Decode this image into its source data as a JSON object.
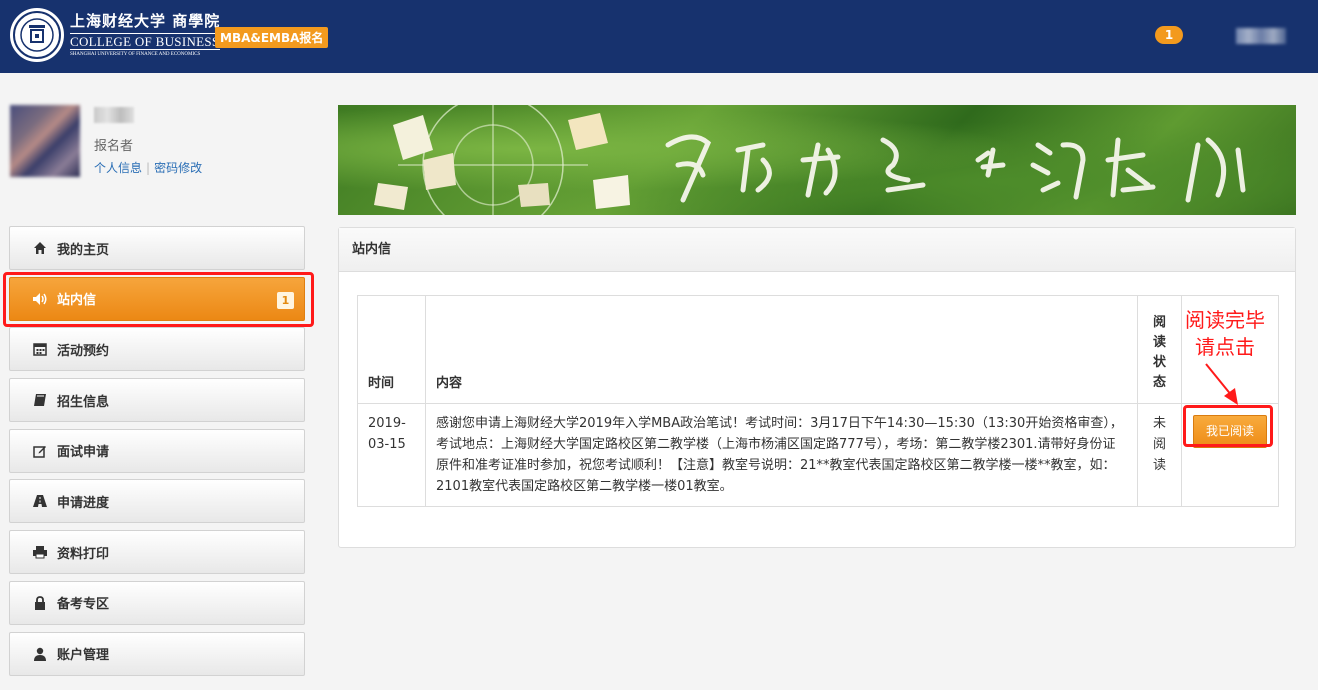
{
  "header": {
    "logo_cn": "上海财经大学 商學院",
    "logo_en": "COLLEGE OF BUSINESS",
    "logo_en_small": "SHANGHAI UNIVERSITY OF FINANCE AND ECONOMICS",
    "program_badge": "MBA&EMBA报名",
    "notification_count": "1"
  },
  "profile": {
    "role": "报名者",
    "link_personal": "个人信息",
    "link_password": "密码修改"
  },
  "sidebar": {
    "items": [
      {
        "label": "我的主页",
        "icon": "home-icon"
      },
      {
        "label": "站内信",
        "icon": "volume-icon",
        "count": "1",
        "active": true
      },
      {
        "label": "活动预约",
        "icon": "calendar-icon"
      },
      {
        "label": "招生信息",
        "icon": "book-icon"
      },
      {
        "label": "面试申请",
        "icon": "edit-icon"
      },
      {
        "label": "申请进度",
        "icon": "road-icon"
      },
      {
        "label": "资料打印",
        "icon": "print-icon"
      },
      {
        "label": "备考专区",
        "icon": "lock-icon"
      },
      {
        "label": "账户管理",
        "icon": "user-icon"
      }
    ]
  },
  "panel": {
    "title": "站内信",
    "columns": {
      "time": "时间",
      "content": "内容",
      "status": "阅读状态"
    },
    "rows": [
      {
        "date": "2019-03-15",
        "content": "感谢您申请上海财经大学2019年入学MBA政治笔试！考试时间：3月17日下午14:30—15:30（13:30开始资格审查），考试地点：上海财经大学国定路校区第二教学楼（上海市杨浦区国定路777号），考场：第二教学楼2301.请带好身份证原件和准考证准时参加，祝您考试顺利！【注意】教室号说明：21**教室代表国定路校区第二教学楼一楼**教室，如：2101教室代表国定路校区第二教学楼一楼01教室。",
        "status": "未阅读",
        "button": "我已阅读"
      }
    ]
  },
  "annotation": {
    "line1": "阅读完毕",
    "line2": "请点击"
  },
  "colors": {
    "header_bg": "#17326e",
    "accent": "#f39a1e",
    "highlight": "#ff1a1a"
  }
}
